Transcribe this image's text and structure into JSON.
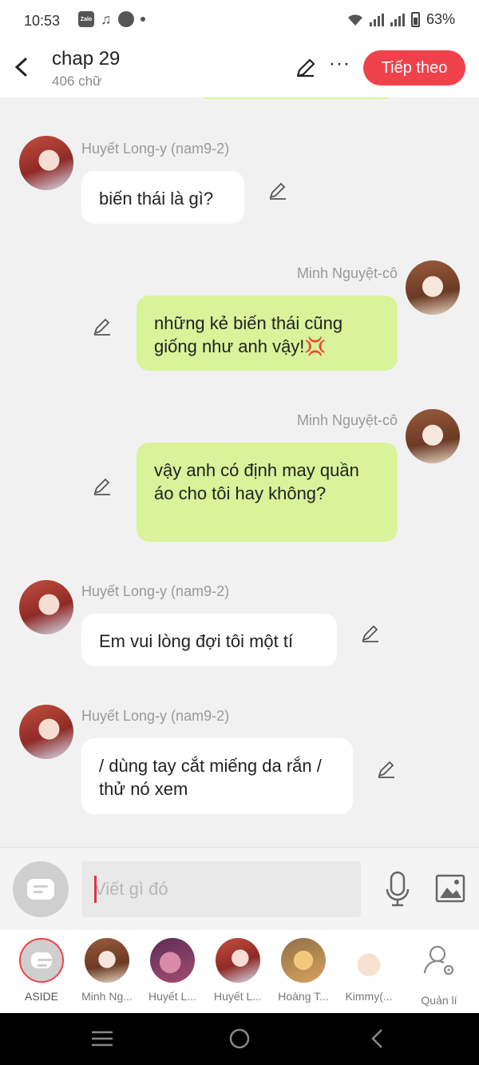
{
  "status_bar": {
    "time": "10:53",
    "battery": "63%",
    "app_icon_label": "Zalo"
  },
  "header": {
    "title": "chap 29",
    "subtitle": "406 chữ",
    "next_label": "Tiếp theo"
  },
  "messages": [
    {
      "side": "left",
      "sender": "Huyết Long-y (nam9-2)",
      "text": "biến thái là gì?"
    },
    {
      "side": "right",
      "sender": "Minh Nguyệt-cô",
      "text": "những kẻ biến thái cũng giống như anh vậy!💢"
    },
    {
      "side": "right",
      "sender": "Minh Nguyệt-cô",
      "text": "vậy anh có định may quần áo cho tôi hay không?"
    },
    {
      "side": "left",
      "sender": "Huyết Long-y (nam9-2)",
      "text": "Em vui lòng đợi tôi một tí"
    },
    {
      "side": "left",
      "sender": "Huyết Long-y (nam9-2)",
      "text": "/ dùng tay cắt miếng da rắn / thử nó xem"
    }
  ],
  "compose": {
    "placeholder": "Viết gì đó"
  },
  "characters": [
    {
      "label": "ASIDE"
    },
    {
      "label": "Minh Ng..."
    },
    {
      "label": "Huyết L..."
    },
    {
      "label": "Huyết L..."
    },
    {
      "label": "Hoàng T..."
    },
    {
      "label": "Kimmy(..."
    },
    {
      "label": "Quản lí"
    }
  ],
  "icons": {
    "back": "chevron-left-icon",
    "edit": "pencil-icon",
    "more": "more-dots-icon",
    "mic": "microphone-icon",
    "image": "image-icon",
    "settings": "user-settings-icon"
  },
  "colors": {
    "accent": "#f0424a",
    "right_bubble": "#d8f39a",
    "left_bubble": "#ffffff",
    "background": "#f1f1f1"
  }
}
